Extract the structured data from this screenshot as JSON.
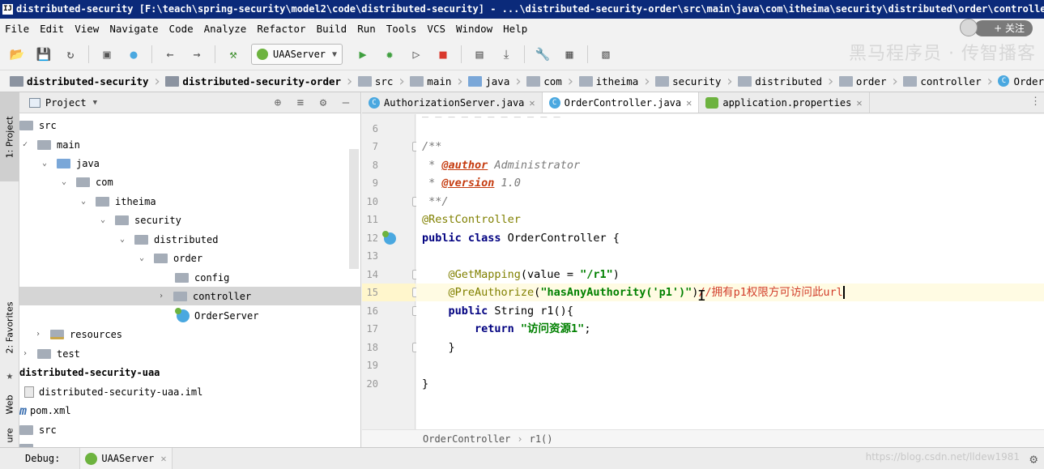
{
  "window": {
    "title": "distributed-security [F:\\teach\\spring-security\\model2\\code\\distributed-security] - ...\\distributed-security-order\\src\\main\\java\\com\\itheima\\security\\distributed\\order\\controller\\Ord..."
  },
  "menu": [
    "File",
    "Edit",
    "View",
    "Navigate",
    "Code",
    "Analyze",
    "Refactor",
    "Build",
    "Run",
    "Tools",
    "VCS",
    "Window",
    "Help"
  ],
  "overlay": {
    "follow_label": "+ 关注",
    "watermark": "黑马程序员 · 传智播客"
  },
  "toolbar": {
    "run_config": "UAAServer"
  },
  "breadcrumb": [
    "distributed-security",
    "distributed-security-order",
    "src",
    "main",
    "java",
    "com",
    "itheima",
    "security",
    "distributed",
    "order",
    "controller",
    "OrderContro"
  ],
  "sidebar_tabs": {
    "project": "1: Project",
    "favorites": "2: Favorites",
    "web": "Web",
    "structure": "ure"
  },
  "project_panel": {
    "title": "Project",
    "tree": [
      "src",
      "main",
      "java",
      "com",
      "itheima",
      "security",
      "distributed",
      "order",
      "config",
      "controller",
      "OrderServer",
      "resources",
      "test",
      "distributed-security-uaa",
      "distributed-security-uaa.iml",
      "pom.xml",
      "src"
    ]
  },
  "editor": {
    "tabs": [
      "AuthorizationServer.java",
      "OrderController.java",
      "application.properties"
    ],
    "line_numbers": [
      "6",
      "7",
      "8",
      "9",
      "10",
      "11",
      "12",
      "13",
      "14",
      "15",
      "16",
      "17",
      "18",
      "19",
      "20"
    ],
    "code": {
      "l7": "/**",
      "l8_prefix": " * ",
      "l8_tag": "@author",
      "l8_rest": " Administrator",
      "l9_prefix": " * ",
      "l9_tag": "@version",
      "l9_rest": " 1.0",
      "l10": " **/",
      "l11": "@RestController",
      "l12_kw": "public class",
      "l12_rest": " OrderController {",
      "l14_ann": "    @GetMapping",
      "l14_mid": "(value = ",
      "l14_str": "\"/r1\"",
      "l14_end": ")",
      "l15_ann": "    @PreAuthorize",
      "l15_mid": "(",
      "l15_str": "\"hasAnyAuthority('p1')\"",
      "l15_end": ")",
      "l15_comment": "//拥有p1权限方可访问此url",
      "l16_kw": "    public",
      "l16_rest": " String r1(){",
      "l17_kw": "        return",
      "l17_str": " \"访问资源1\"",
      "l17_end": ";",
      "l18": "    }",
      "l20": "}"
    },
    "status_crumbs": [
      "OrderController",
      "r1()"
    ]
  },
  "debug_bar": {
    "label": "Debug:",
    "tab": "UAAServer",
    "url_watermark": "https://blog.csdn.net/lldew1981"
  }
}
